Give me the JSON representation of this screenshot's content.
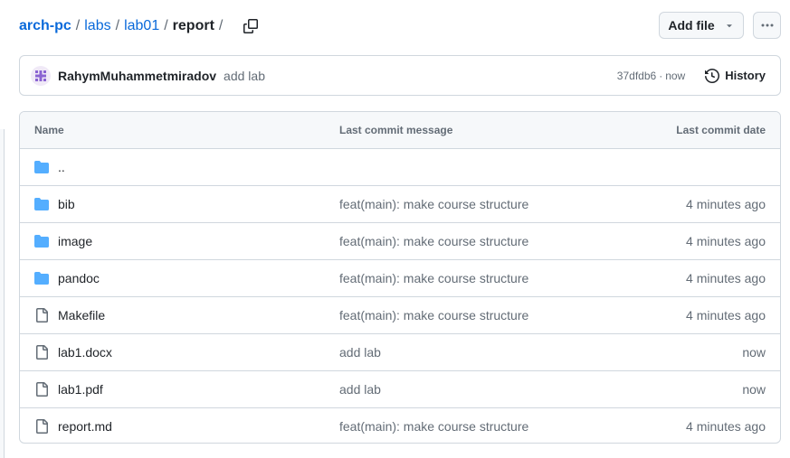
{
  "breadcrumb": {
    "repo": "arch-pc",
    "sep": "/",
    "path": [
      "labs",
      "lab01"
    ],
    "current": "report"
  },
  "toolbar": {
    "add_file_label": "Add file",
    "more_label": "More options"
  },
  "latest_commit": {
    "author": "RahymMuhammetmiradov",
    "message": "add lab",
    "sha": "37dfdb6",
    "dot": "·",
    "time": "now",
    "history_label": "History"
  },
  "table": {
    "headers": {
      "name": "Name",
      "message": "Last commit message",
      "date": "Last commit date"
    },
    "parent_dir": "..",
    "rows": [
      {
        "type": "folder",
        "name": "bib",
        "message": "feat(main): make course structure",
        "date": "4 minutes ago"
      },
      {
        "type": "folder",
        "name": "image",
        "message": "feat(main): make course structure",
        "date": "4 minutes ago"
      },
      {
        "type": "folder",
        "name": "pandoc",
        "message": "feat(main): make course structure",
        "date": "4 minutes ago"
      },
      {
        "type": "file",
        "name": "Makefile",
        "message": "feat(main): make course structure",
        "date": "4 minutes ago"
      },
      {
        "type": "file",
        "name": "lab1.docx",
        "message": "add lab",
        "date": "now"
      },
      {
        "type": "file",
        "name": "lab1.pdf",
        "message": "add lab",
        "date": "now"
      },
      {
        "type": "file",
        "name": "report.md",
        "message": "feat(main): make course structure",
        "date": "4 minutes ago"
      }
    ]
  },
  "colors": {
    "link": "#0969da",
    "folder": "#54aeff",
    "muted": "#636c76",
    "border": "#d0d7de"
  },
  "icons": {
    "copy": "copy-icon",
    "dropdown": "triangle-down-icon",
    "more": "kebab-horizontal-icon",
    "history": "history-icon",
    "folder": "folder-icon",
    "file": "file-icon"
  }
}
